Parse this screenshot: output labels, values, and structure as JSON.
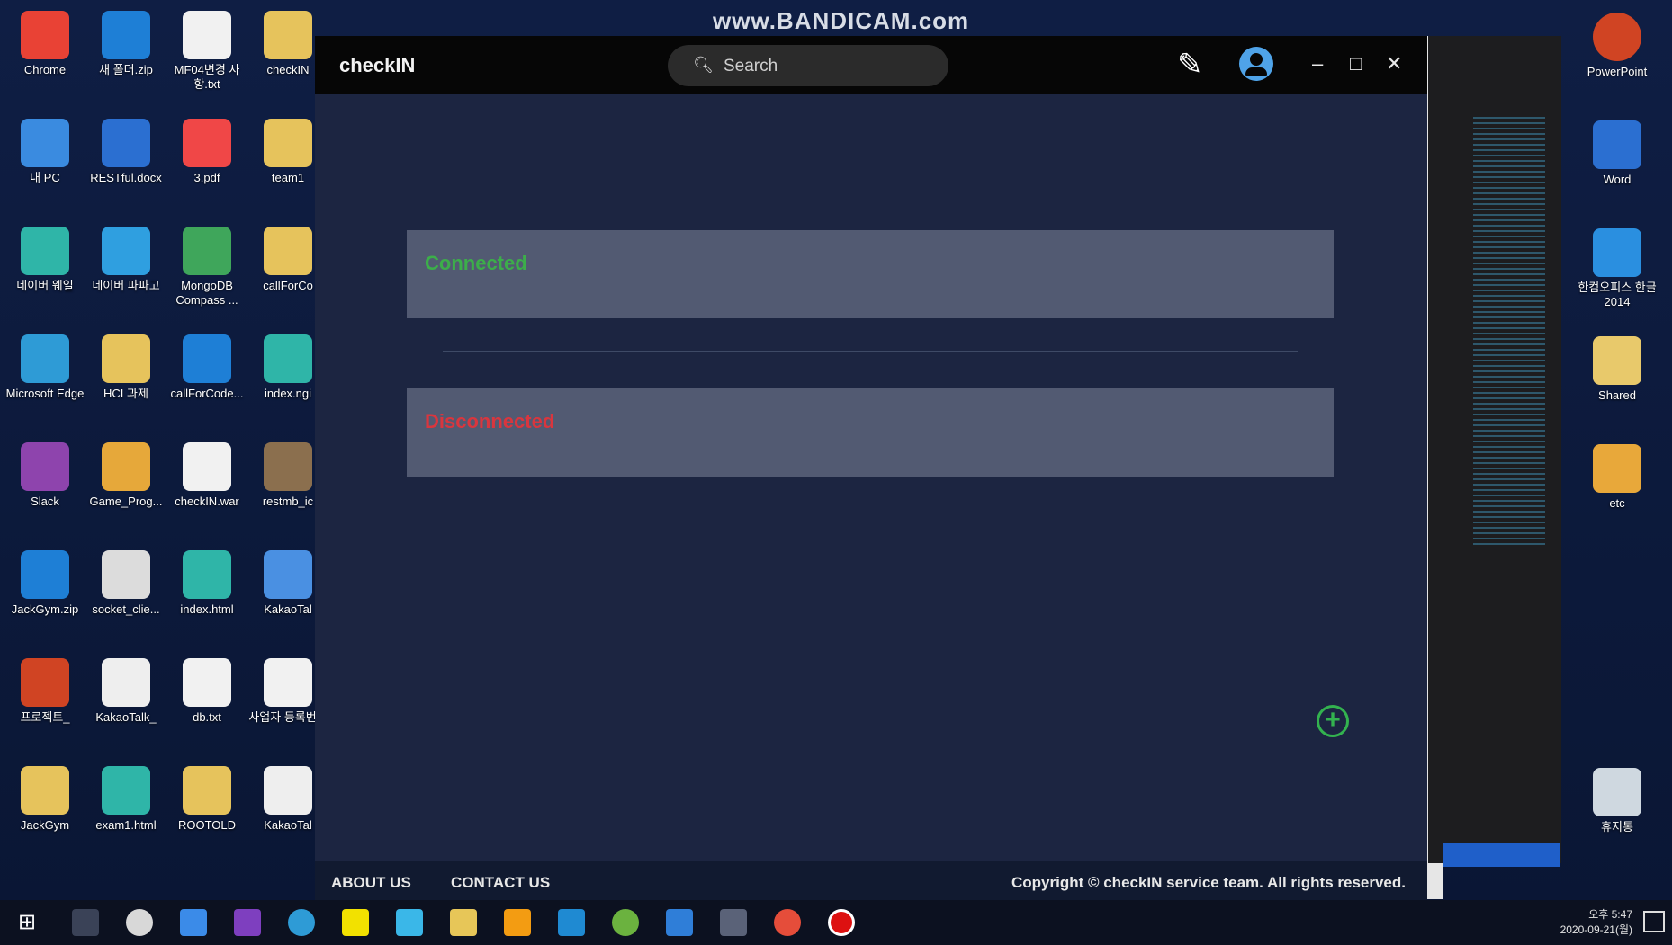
{
  "watermark": "www.BANDICAM.com",
  "desktop": {
    "icons": [
      "Chrome",
      "새 폴더.zip",
      "MF04변경 사항.txt",
      "checkIN",
      "내 PC",
      "RESTful.docx",
      "3.pdf",
      "team1",
      "네이버 웨일",
      "네이버 파파고",
      "MongoDB Compass ...",
      "callForCo",
      "Microsoft Edge",
      "HCI 과제",
      "callForCode...",
      "index.ngi",
      "Slack",
      "Game_Prog...",
      "checkIN.war",
      "restmb_ic",
      "JackGym.zip",
      "socket_clie...",
      "index.html",
      "KakaoTal",
      "프로젝트_",
      "KakaoTalk_",
      "db.txt",
      "사업자 등록번호",
      "JackGym",
      "exam1.html",
      "ROOTOLD",
      "KakaoTal"
    ],
    "right_icons": [
      "PowerPoint",
      "Word",
      "한컴오피스 한글 2014",
      "Shared",
      "etc",
      "휴지통"
    ]
  },
  "app": {
    "brand": "checkIN",
    "search_placeholder": "Search",
    "cards": [
      {
        "status": "Connected",
        "color": "#3cae4a"
      },
      {
        "status": "Disconnected",
        "color": "#d9363e"
      }
    ],
    "footer": {
      "about": "ABOUT US",
      "contact": "CONTACT US",
      "copyright": "Copyright © checkIN service team. All rights reserved."
    }
  },
  "taskbar": {
    "time": "오후 5:47",
    "date": "2020-09-21(월)"
  }
}
